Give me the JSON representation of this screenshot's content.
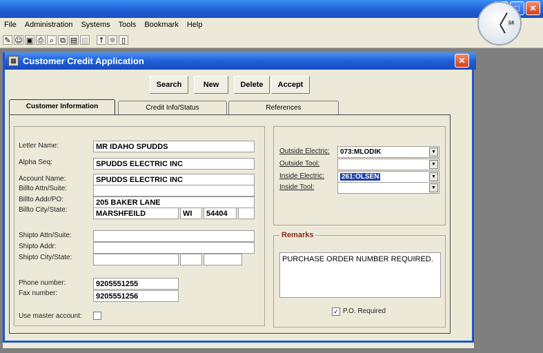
{
  "outer": {
    "ctrl_min": "_",
    "ctrl_max": "□",
    "ctrl_close": "✕"
  },
  "menu": [
    "File",
    "Administration",
    "Systems",
    "Tools",
    "Bookmark",
    "Help"
  ],
  "toolbar_icons": [
    "new-icon",
    "user-icon",
    "save-icon",
    "print-icon",
    "find-icon",
    "copy-icon",
    "report-icon",
    "disabled-icon",
    "up-arrow-icon",
    "lightbulb-icon",
    "trash-icon"
  ],
  "clock": {
    "label": "14"
  },
  "window": {
    "title": "Customer Credit Application",
    "close": "✕",
    "buttons": {
      "search": "Search",
      "new": "New",
      "delete": "Delete",
      "accept": "Accept"
    },
    "tabs": [
      "Customer Information",
      "Credit Info/Status",
      "References"
    ]
  },
  "customer": {
    "letter_name_label": "Letter Name:",
    "letter_name": "MR IDAHO SPUDDS",
    "alpha_seq_label": "Alpha Seq:",
    "alpha_seq": "SPUDDS ELECTRIC INC",
    "account_name_label": "Account Name:",
    "account_name": "SPUDDS ELECTRIC INC",
    "billto_attn_label": "Billto Attn/Suite:",
    "billto_attn": "",
    "billto_addr_label": "Billto Addr/PO:",
    "billto_addr": "205 BAKER LANE",
    "billto_city_label": "Billto City/State:",
    "billto_city": "MARSHFEILD",
    "billto_state": "WI",
    "billto_zip": "54404",
    "billto_extra": "",
    "shipto_attn_label": "Shipto Attn/Suite:",
    "shipto_addr_label": "Shipto Addr:",
    "shipto_city_label": "Shipto City/State:",
    "phone_label": "Phone number:",
    "phone": "9205551255",
    "fax_label": "Fax number:",
    "fax": "9205551256",
    "master_label": "Use master account:"
  },
  "sales": {
    "outside_electric_label": "Outside Electric:",
    "outside_electric": "073:MLODIK",
    "outside_tool_label": "Outside Tool:",
    "outside_tool": "",
    "inside_electric_label": "Inside Electric:",
    "inside_electric": "261:OLSEN",
    "inside_tool_label": "Inside Tool:",
    "inside_tool": ""
  },
  "remarks": {
    "title": "Remarks",
    "text": "PURCHASE ORDER NUMBER REQUIRED.",
    "po_required_label": "P.O. Required",
    "po_required_mark": "✓"
  }
}
